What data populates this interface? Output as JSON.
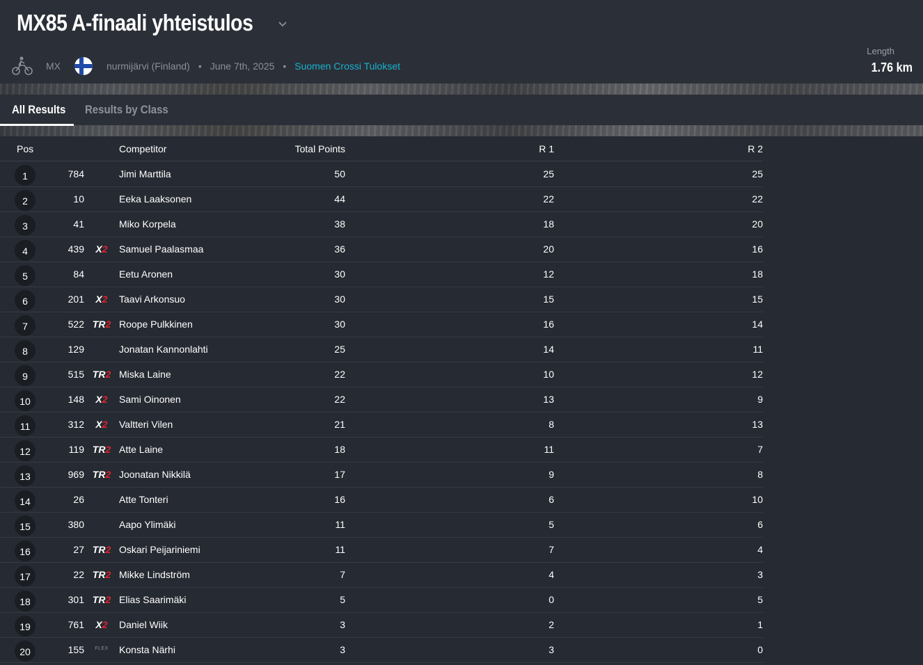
{
  "event": {
    "title": "MX85 A-finaali yhteistulos",
    "sport": "MX",
    "location": "nurmijärvi (Finland)",
    "date": "June 7th, 2025",
    "organizer": "Suomen Crossi Tulokset",
    "length_label": "Length",
    "length_value": "1.76 km"
  },
  "tabs": {
    "all_results": "All Results",
    "results_by_class": "Results by Class"
  },
  "table": {
    "headers": {
      "pos": "Pos",
      "competitor": "Competitor",
      "total": "Total Points",
      "r1": "R 1",
      "r2": "R 2"
    },
    "rows": [
      {
        "pos": "1",
        "num": "784",
        "brand": "",
        "name": "Jimi Marttila",
        "total": "50",
        "r1": "25",
        "r2": "25"
      },
      {
        "pos": "2",
        "num": "10",
        "brand": "",
        "name": "Eeka Laaksonen",
        "total": "44",
        "r1": "22",
        "r2": "22"
      },
      {
        "pos": "3",
        "num": "41",
        "brand": "",
        "name": "Miko Korpela",
        "total": "38",
        "r1": "18",
        "r2": "20"
      },
      {
        "pos": "4",
        "num": "439",
        "brand": "X2",
        "name": "Samuel Paalasmaa",
        "total": "36",
        "r1": "20",
        "r2": "16"
      },
      {
        "pos": "5",
        "num": "84",
        "brand": "",
        "name": "Eetu Aronen",
        "total": "30",
        "r1": "12",
        "r2": "18"
      },
      {
        "pos": "6",
        "num": "201",
        "brand": "X2",
        "name": "Taavi Arkonsuo",
        "total": "30",
        "r1": "15",
        "r2": "15"
      },
      {
        "pos": "7",
        "num": "522",
        "brand": "TR2",
        "name": "Roope Pulkkinen",
        "total": "30",
        "r1": "16",
        "r2": "14"
      },
      {
        "pos": "8",
        "num": "129",
        "brand": "",
        "name": "Jonatan Kannonlahti",
        "total": "25",
        "r1": "14",
        "r2": "11"
      },
      {
        "pos": "9",
        "num": "515",
        "brand": "TR2",
        "name": "Miska Laine",
        "total": "22",
        "r1": "10",
        "r2": "12"
      },
      {
        "pos": "10",
        "num": "148",
        "brand": "X2",
        "name": "Sami Oinonen",
        "total": "22",
        "r1": "13",
        "r2": "9"
      },
      {
        "pos": "11",
        "num": "312",
        "brand": "X2",
        "name": "Valtteri Vilen",
        "total": "21",
        "r1": "8",
        "r2": "13"
      },
      {
        "pos": "12",
        "num": "119",
        "brand": "TR2",
        "name": "Atte Laine",
        "total": "18",
        "r1": "11",
        "r2": "7"
      },
      {
        "pos": "13",
        "num": "969",
        "brand": "TR2",
        "name": "Joonatan Nikkilä",
        "total": "17",
        "r1": "9",
        "r2": "8"
      },
      {
        "pos": "14",
        "num": "26",
        "brand": "",
        "name": "Atte Tonteri",
        "total": "16",
        "r1": "6",
        "r2": "10"
      },
      {
        "pos": "15",
        "num": "380",
        "brand": "",
        "name": "Aapo Ylimäki",
        "total": "11",
        "r1": "5",
        "r2": "6"
      },
      {
        "pos": "16",
        "num": "27",
        "brand": "TR2",
        "name": "Oskari Peijariniemi",
        "total": "11",
        "r1": "7",
        "r2": "4"
      },
      {
        "pos": "17",
        "num": "22",
        "brand": "TR2",
        "name": "Mikke Lindström",
        "total": "7",
        "r1": "4",
        "r2": "3"
      },
      {
        "pos": "18",
        "num": "301",
        "brand": "TR2",
        "name": "Elias Saarimäki",
        "total": "5",
        "r1": "0",
        "r2": "5"
      },
      {
        "pos": "19",
        "num": "761",
        "brand": "X2",
        "name": "Daniel Wiik",
        "total": "3",
        "r1": "2",
        "r2": "1"
      },
      {
        "pos": "20",
        "num": "155",
        "brand": "FLEX",
        "name": "Konsta Närhi",
        "total": "3",
        "r1": "3",
        "r2": "0"
      }
    ]
  },
  "colors": {
    "background": "#262a32",
    "header": "#2b2f37",
    "link": "#19b3d1",
    "brand_red": "#e0232b"
  },
  "icons": {
    "sport": "motocross-bike-icon",
    "flag": "finland-flag-icon",
    "dropdown": "chevron-down-icon"
  }
}
